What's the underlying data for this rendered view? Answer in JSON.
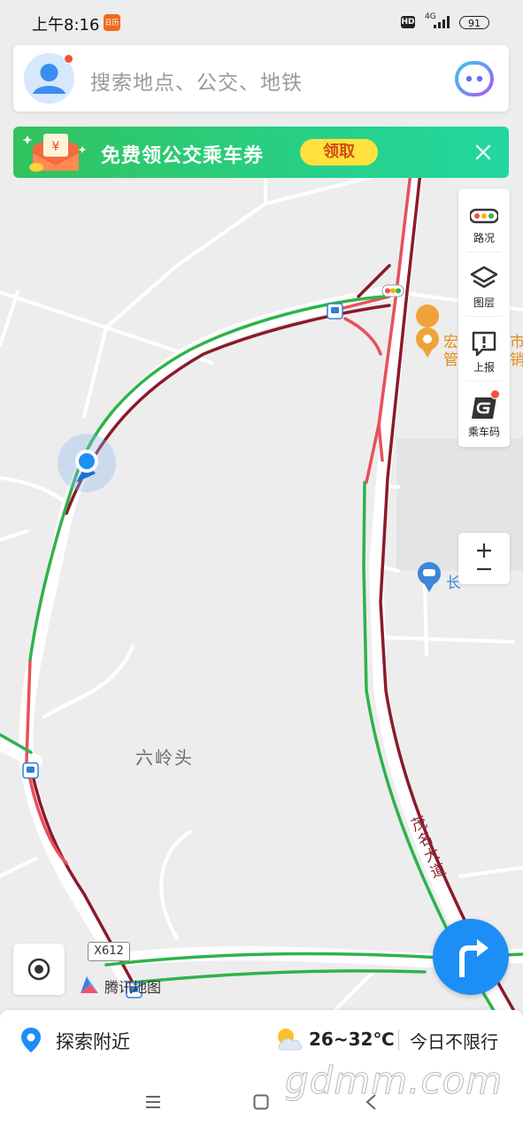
{
  "status_bar": {
    "time": "上午8:16",
    "app_badge": "日历",
    "hd": "HD",
    "network": "4G",
    "battery": "91"
  },
  "search": {
    "placeholder": "搜索地点、公交、地铁"
  },
  "banner": {
    "text": "免费领公交乘车券",
    "claim_label": "领取"
  },
  "tools": [
    {
      "icon": "traffic-icon",
      "label": "路况"
    },
    {
      "icon": "layers-icon",
      "label": "图层"
    },
    {
      "icon": "report-icon",
      "label": "上报"
    },
    {
      "icon": "ride-code-icon",
      "label": "乘车码"
    }
  ],
  "map": {
    "place_label": "六岭头",
    "road_name": "茂名大道",
    "road_shield": "X612",
    "poi_1": "宏",
    "poi_1b": "管",
    "poi_2": "市",
    "poi_2b": "销",
    "poi_3": "长",
    "colors": {
      "congested": "#8b1a2b",
      "slow": "#e8505b",
      "smooth": "#2fb34a",
      "accent": "#1d8ef5"
    }
  },
  "logo": {
    "text": "腾讯地图"
  },
  "bottom": {
    "explore_label": "探索附近",
    "temperature": "26~32℃",
    "restriction": "今日不限行"
  },
  "watermark": "gdmm.com"
}
